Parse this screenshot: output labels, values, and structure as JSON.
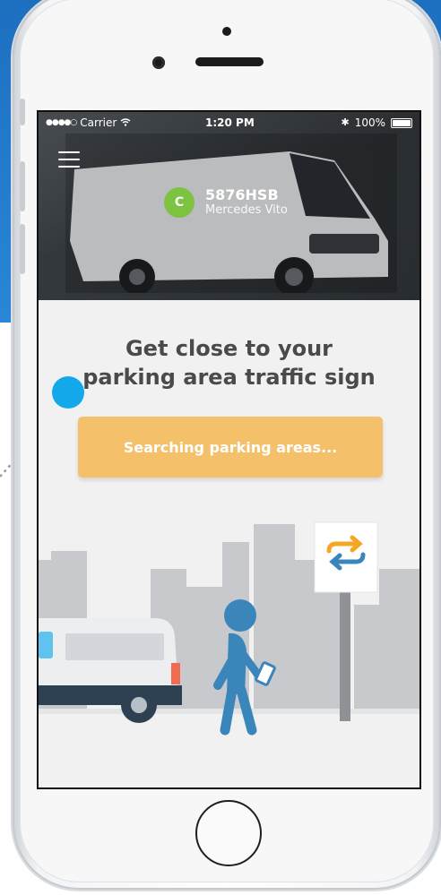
{
  "status_bar": {
    "carrier": "Carrier",
    "time": "1:20 PM",
    "battery": "100%"
  },
  "vehicle": {
    "category": "C",
    "plate": "5876HSB",
    "model": "Mercedes Vito"
  },
  "main": {
    "title_line1": "Get close to your",
    "title_line2": "parking area traffic sign",
    "search_label": "Searching parking areas..."
  },
  "colors": {
    "accent_button": "#f5c06a",
    "badge_green": "#7cc342",
    "highlight_dot": "#12a8ea",
    "illustration_blue": "#3a86bb"
  },
  "icons": [
    "menu-icon",
    "wifi-icon",
    "bluetooth-icon",
    "battery-icon",
    "swap-arrows-icon"
  ]
}
